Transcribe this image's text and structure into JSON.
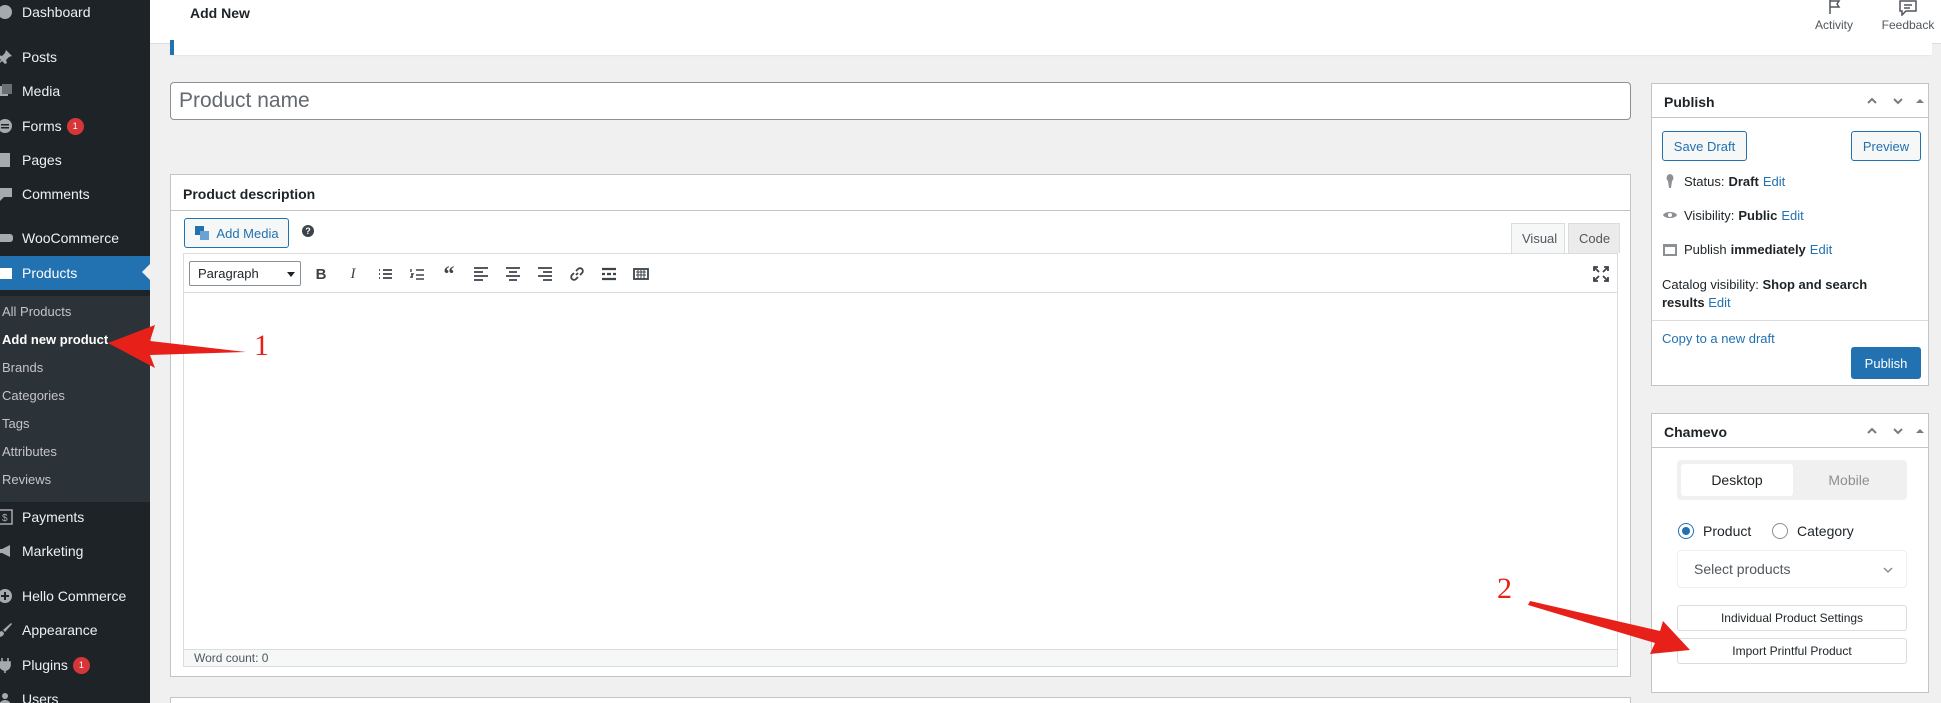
{
  "sidebar": {
    "items": [
      {
        "label": "Dashboard",
        "icon": "dashboard-icon"
      },
      {
        "label": "Posts",
        "icon": "pin-icon"
      },
      {
        "label": "Media",
        "icon": "media-icon"
      },
      {
        "label": "Forms",
        "icon": "forms-icon",
        "badge": "1"
      },
      {
        "label": "Pages",
        "icon": "pages-icon"
      },
      {
        "label": "Comments",
        "icon": "comment-icon"
      },
      {
        "label": "WooCommerce",
        "icon": "woo-icon"
      },
      {
        "label": "Products",
        "icon": "products-icon"
      },
      {
        "label": "Payments",
        "icon": "payments-icon"
      },
      {
        "label": "Marketing",
        "icon": "megaphone-icon"
      },
      {
        "label": "Hello Commerce",
        "icon": "plus-circle-icon"
      },
      {
        "label": "Appearance",
        "icon": "brush-icon"
      },
      {
        "label": "Plugins",
        "icon": "plug-icon",
        "badge": "1"
      },
      {
        "label": "Users",
        "icon": "users-icon"
      }
    ],
    "submenu": [
      "All Products",
      "Add new product",
      "Brands",
      "Categories",
      "Tags",
      "Attributes",
      "Reviews"
    ]
  },
  "topbar": {
    "heading": "Add New",
    "activity": "Activity",
    "feedback": "Feedback"
  },
  "product": {
    "name_placeholder": "Product name"
  },
  "editor": {
    "title": "Product description",
    "add_media": "Add Media",
    "help": "?",
    "tab_visual": "Visual",
    "tab_code": "Code",
    "format": "Paragraph",
    "word_count": "Word count: 0"
  },
  "publish": {
    "title": "Publish",
    "save_draft": "Save Draft",
    "preview": "Preview",
    "status_label": "Status:",
    "status_value": "Draft",
    "visibility_label": "Visibility:",
    "visibility_value": "Public",
    "publish_label": "Publish",
    "publish_value": "immediately",
    "edit": "Edit",
    "catalog_label": "Catalog visibility:",
    "catalog_value": "Shop and search results",
    "copy_draft": "Copy to a new draft",
    "publish_button": "Publish"
  },
  "chamevo": {
    "title": "Chamevo",
    "seg_desktop": "Desktop",
    "seg_mobile": "Mobile",
    "radio_product": "Product",
    "radio_category": "Category",
    "select_placeholder": "Select products",
    "individual_settings": "Individual Product Settings",
    "import_printful": "Import Printful Product"
  },
  "annotations": {
    "one": "1",
    "two": "2"
  },
  "colors": {
    "accent": "#2271b1",
    "sidebar_bg": "#1d2327",
    "badge": "#d63638",
    "annotation": "#e8201a"
  }
}
